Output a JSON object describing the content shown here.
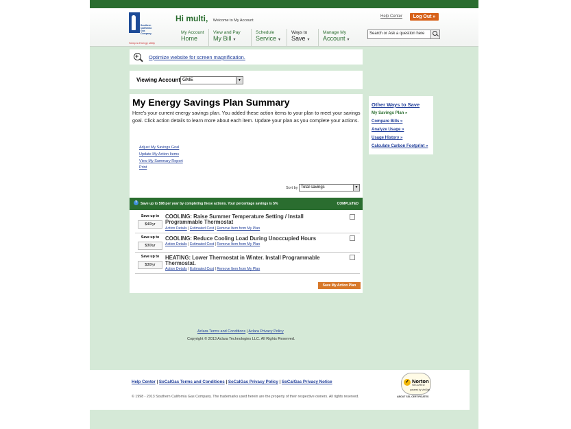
{
  "header": {
    "logo_text": "Southern California Gas Company",
    "logo_tagline": "Sempra Energy utility",
    "greeting": "Hi multi,",
    "welcome": "Welcome to My Account",
    "help_center": "Help Center",
    "logout": "Log Out »",
    "search_placeholder": "Search or Ask a question here",
    "nav": [
      {
        "small": "My Account",
        "big": "Home"
      },
      {
        "small": "View and Pay",
        "big": "My Bill"
      },
      {
        "small": "Schedule",
        "big": "Service"
      },
      {
        "small": "Ways to",
        "big": "Save"
      },
      {
        "small": "Manage My",
        "big": "Account"
      }
    ]
  },
  "magnify": {
    "link": "Optimize website for screen magnification."
  },
  "viewing": {
    "label": "Viewing Account:",
    "account": "GME"
  },
  "main": {
    "title": "My Energy Savings Plan Summary",
    "intro": "Here's your current energy savings plan. You added these action items to your plan to meet your savings goal. Click action details to learn more about each item. Update your plan as you complete your actions.",
    "actions": [
      "Adjust My Savings Goal",
      "Update My Action Items",
      "View My Summary Report",
      "Print"
    ],
    "sort_label": "Sort by",
    "sort_value": "Total savings",
    "banner": "Save up to $98 per year by completing these actions. Your percentage savings is 5%",
    "completed": "COMPLETED",
    "items": [
      {
        "save_label": "Save up to",
        "amount": "$40/yr",
        "title": "COOLING: Raise Summer Temperature Setting / Install Programmable Thermostat",
        "details": "Action Details",
        "cost": "Estimated Cost",
        "remove": "Remove Item from My Plan"
      },
      {
        "save_label": "Save up to",
        "amount": "$30/yr",
        "title": "COOLING: Reduce Cooling Load During Unoccupied Hours",
        "details": "Action Details",
        "cost": "Estimated Cost",
        "remove": "Remove Item from My Plan"
      },
      {
        "save_label": "Save up to",
        "amount": "$30/yr",
        "title": "HEATING: Lower Thermostat in Winter. Install Programmable Thermostat.",
        "details": "Action Details",
        "cost": "Estimated Cost",
        "remove": "Remove Item from My Plan"
      }
    ],
    "save_button": "Save My Action Plan"
  },
  "sidebar": {
    "title": "Other Ways to Save",
    "links": [
      "My Savings Plan »",
      "Compare Bills »",
      "Analyze Usage »",
      "Usage History »",
      "Calculate Carbon Footprint »"
    ]
  },
  "aclara": {
    "terms": "Aclara Terms and Conditions",
    "privacy": "Aclara Privacy Policy",
    "copyright": "Copyright © 2013 Aclara Technologies LLC. All Rights Reserved."
  },
  "footer": {
    "links": [
      "Help Center",
      "SoCalGas Terms and Conditions",
      "SoCalGas Privacy Policy",
      "SoCalGas Privacy Notice"
    ],
    "copyright": "© 1998 - 2013 Southern California Gas Company. The trademarks used herein are the property of their respective owners. All rights reserved.",
    "norton": {
      "name": "Norton",
      "secured": "SECURED",
      "powered": "powered by VeriSign",
      "about": "ABOUT SSL CERTIFICATES"
    }
  },
  "colors": {
    "brand_green": "#2a6d2f",
    "page_bg": "#d5e9d7",
    "logout_orange": "#d7621a",
    "link_blue": "#1f3d99"
  }
}
